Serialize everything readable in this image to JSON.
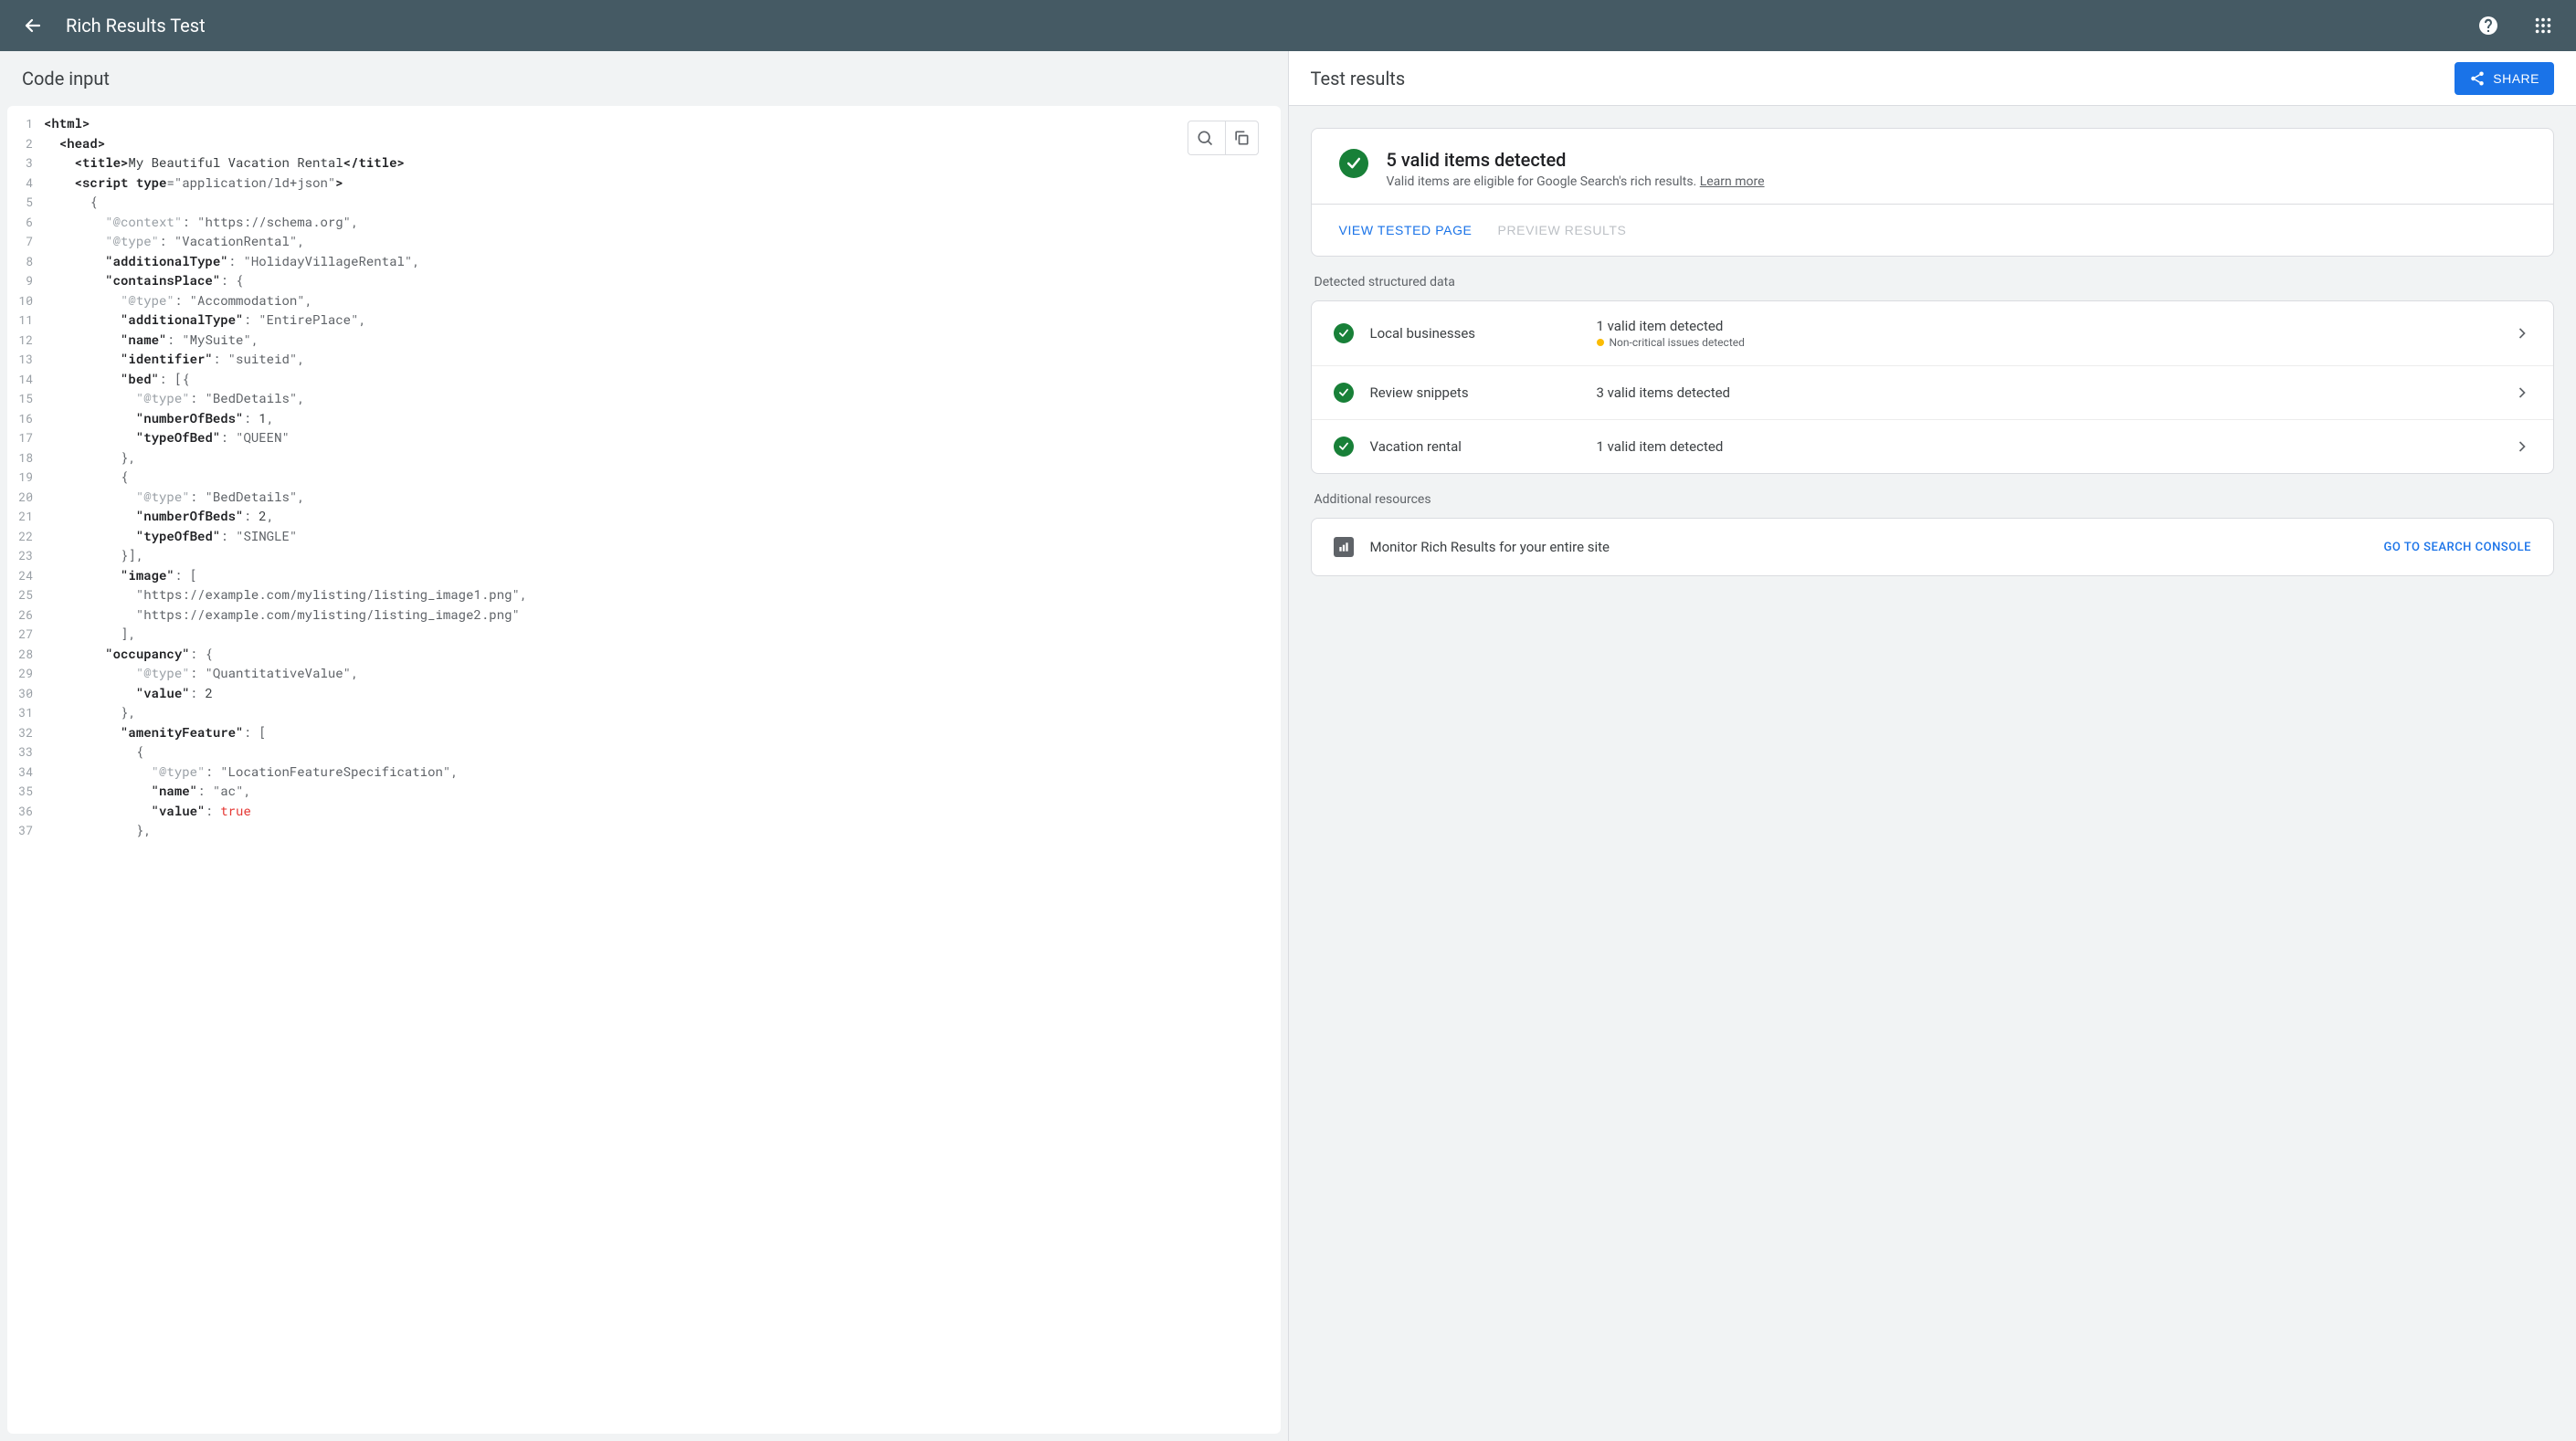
{
  "topbar": {
    "title": "Rich Results Test"
  },
  "left": {
    "title": "Code input",
    "code_lines": [
      {
        "n": 1,
        "tokens": [
          [
            "tag",
            "<html>"
          ]
        ]
      },
      {
        "n": 2,
        "tokens": [
          [
            "txt",
            "  "
          ],
          [
            "tag",
            "<head>"
          ]
        ]
      },
      {
        "n": 3,
        "tokens": [
          [
            "txt",
            "    "
          ],
          [
            "tag",
            "<title>"
          ],
          [
            "txt",
            "My Beautiful Vacation Rental"
          ],
          [
            "tag",
            "</title>"
          ]
        ]
      },
      {
        "n": 4,
        "tokens": [
          [
            "txt",
            "    "
          ],
          [
            "tag",
            "<script "
          ],
          [
            "attr",
            "type"
          ],
          [
            "punc",
            "="
          ],
          [
            "str",
            "\"application/ld+json\""
          ],
          [
            "tag",
            ">"
          ]
        ]
      },
      {
        "n": 5,
        "tokens": [
          [
            "txt",
            "      "
          ],
          [
            "punc",
            "{"
          ]
        ]
      },
      {
        "n": 6,
        "tokens": [
          [
            "txt",
            "        "
          ],
          [
            "keygray",
            "\"@context\""
          ],
          [
            "punc",
            ": "
          ],
          [
            "str",
            "\"https://schema.org\""
          ],
          [
            "punc",
            ","
          ]
        ]
      },
      {
        "n": 7,
        "tokens": [
          [
            "txt",
            "        "
          ],
          [
            "keygray",
            "\"@type\""
          ],
          [
            "punc",
            ": "
          ],
          [
            "str",
            "\"VacationRental\""
          ],
          [
            "punc",
            ","
          ]
        ]
      },
      {
        "n": 8,
        "tokens": [
          [
            "txt",
            "        "
          ],
          [
            "key",
            "\"additionalType\""
          ],
          [
            "punc",
            ": "
          ],
          [
            "str",
            "\"HolidayVillageRental\""
          ],
          [
            "punc",
            ","
          ]
        ]
      },
      {
        "n": 9,
        "tokens": [
          [
            "txt",
            "        "
          ],
          [
            "key",
            "\"containsPlace\""
          ],
          [
            "punc",
            ": {"
          ]
        ]
      },
      {
        "n": 10,
        "tokens": [
          [
            "txt",
            "          "
          ],
          [
            "keygray",
            "\"@type\""
          ],
          [
            "punc",
            ": "
          ],
          [
            "str",
            "\"Accommodation\""
          ],
          [
            "punc",
            ","
          ]
        ]
      },
      {
        "n": 11,
        "tokens": [
          [
            "txt",
            "          "
          ],
          [
            "key",
            "\"additionalType\""
          ],
          [
            "punc",
            ": "
          ],
          [
            "str",
            "\"EntirePlace\""
          ],
          [
            "punc",
            ","
          ]
        ]
      },
      {
        "n": 12,
        "tokens": [
          [
            "txt",
            "          "
          ],
          [
            "key",
            "\"name\""
          ],
          [
            "punc",
            ": "
          ],
          [
            "str",
            "\"MySuite\""
          ],
          [
            "punc",
            ","
          ]
        ]
      },
      {
        "n": 13,
        "tokens": [
          [
            "txt",
            "          "
          ],
          [
            "key",
            "\"identifier\""
          ],
          [
            "punc",
            ": "
          ],
          [
            "str",
            "\"suiteid\""
          ],
          [
            "punc",
            ","
          ]
        ]
      },
      {
        "n": 14,
        "tokens": [
          [
            "txt",
            "          "
          ],
          [
            "key",
            "\"bed\""
          ],
          [
            "punc",
            ": [{"
          ]
        ]
      },
      {
        "n": 15,
        "tokens": [
          [
            "txt",
            "            "
          ],
          [
            "keygray",
            "\"@type\""
          ],
          [
            "punc",
            ": "
          ],
          [
            "str",
            "\"BedDetails\""
          ],
          [
            "punc",
            ","
          ]
        ]
      },
      {
        "n": 16,
        "tokens": [
          [
            "txt",
            "            "
          ],
          [
            "key",
            "\"numberOfBeds\""
          ],
          [
            "punc",
            ": "
          ],
          [
            "num",
            "1"
          ],
          [
            "punc",
            ","
          ]
        ]
      },
      {
        "n": 17,
        "tokens": [
          [
            "txt",
            "            "
          ],
          [
            "key",
            "\"typeOfBed\""
          ],
          [
            "punc",
            ": "
          ],
          [
            "str",
            "\"QUEEN\""
          ]
        ]
      },
      {
        "n": 18,
        "tokens": [
          [
            "txt",
            "          "
          ],
          [
            "punc",
            "},"
          ]
        ]
      },
      {
        "n": 19,
        "tokens": [
          [
            "txt",
            "          "
          ],
          [
            "punc",
            "{"
          ]
        ]
      },
      {
        "n": 20,
        "tokens": [
          [
            "txt",
            "            "
          ],
          [
            "keygray",
            "\"@type\""
          ],
          [
            "punc",
            ": "
          ],
          [
            "str",
            "\"BedDetails\""
          ],
          [
            "punc",
            ","
          ]
        ]
      },
      {
        "n": 21,
        "tokens": [
          [
            "txt",
            "            "
          ],
          [
            "key",
            "\"numberOfBeds\""
          ],
          [
            "punc",
            ": "
          ],
          [
            "num",
            "2"
          ],
          [
            "punc",
            ","
          ]
        ]
      },
      {
        "n": 22,
        "tokens": [
          [
            "txt",
            "            "
          ],
          [
            "key",
            "\"typeOfBed\""
          ],
          [
            "punc",
            ": "
          ],
          [
            "str",
            "\"SINGLE\""
          ]
        ]
      },
      {
        "n": 23,
        "tokens": [
          [
            "txt",
            "          "
          ],
          [
            "punc",
            "}],"
          ]
        ]
      },
      {
        "n": 24,
        "tokens": [
          [
            "txt",
            "          "
          ],
          [
            "key",
            "\"image\""
          ],
          [
            "punc",
            ": ["
          ]
        ]
      },
      {
        "n": 25,
        "tokens": [
          [
            "txt",
            "            "
          ],
          [
            "str",
            "\"https://example.com/mylisting/listing_image1.png\""
          ],
          [
            "punc",
            ","
          ]
        ]
      },
      {
        "n": 26,
        "tokens": [
          [
            "txt",
            "            "
          ],
          [
            "str",
            "\"https://example.com/mylisting/listing_image2.png\""
          ]
        ]
      },
      {
        "n": 27,
        "tokens": [
          [
            "txt",
            "          "
          ],
          [
            "punc",
            "],"
          ]
        ]
      },
      {
        "n": 28,
        "tokens": [
          [
            "txt",
            "        "
          ],
          [
            "key",
            "\"occupancy\""
          ],
          [
            "punc",
            ": {"
          ]
        ]
      },
      {
        "n": 29,
        "tokens": [
          [
            "txt",
            "            "
          ],
          [
            "keygray",
            "\"@type\""
          ],
          [
            "punc",
            ": "
          ],
          [
            "str",
            "\"QuantitativeValue\""
          ],
          [
            "punc",
            ","
          ]
        ]
      },
      {
        "n": 30,
        "tokens": [
          [
            "txt",
            "            "
          ],
          [
            "key",
            "\"value\""
          ],
          [
            "punc",
            ": "
          ],
          [
            "num",
            "2"
          ]
        ]
      },
      {
        "n": 31,
        "tokens": [
          [
            "txt",
            "          "
          ],
          [
            "punc",
            "},"
          ]
        ]
      },
      {
        "n": 32,
        "tokens": [
          [
            "txt",
            "          "
          ],
          [
            "key",
            "\"amenityFeature\""
          ],
          [
            "punc",
            ": ["
          ]
        ]
      },
      {
        "n": 33,
        "tokens": [
          [
            "txt",
            "            "
          ],
          [
            "punc",
            "{"
          ]
        ]
      },
      {
        "n": 34,
        "tokens": [
          [
            "txt",
            "              "
          ],
          [
            "keygray",
            "\"@type\""
          ],
          [
            "punc",
            ": "
          ],
          [
            "str",
            "\"LocationFeatureSpecification\""
          ],
          [
            "punc",
            ","
          ]
        ]
      },
      {
        "n": 35,
        "tokens": [
          [
            "txt",
            "              "
          ],
          [
            "key",
            "\"name\""
          ],
          [
            "punc",
            ": "
          ],
          [
            "str",
            "\"ac\""
          ],
          [
            "punc",
            ","
          ]
        ]
      },
      {
        "n": 36,
        "tokens": [
          [
            "txt",
            "              "
          ],
          [
            "key",
            "\"value\""
          ],
          [
            "punc",
            ": "
          ],
          [
            "true",
            "true"
          ]
        ]
      },
      {
        "n": 37,
        "tokens": [
          [
            "txt",
            "            "
          ],
          [
            "punc",
            "},"
          ]
        ]
      }
    ]
  },
  "right": {
    "title": "Test results",
    "share_label": "SHARE",
    "summary": {
      "title": "5 valid items detected",
      "subtitle_prefix": "Valid items are eligible for Google Search's rich results. ",
      "learn_more": "Learn more",
      "view_tested": "VIEW TESTED PAGE",
      "preview_results": "PREVIEW RESULTS"
    },
    "detected_label": "Detected structured data",
    "items": [
      {
        "name": "Local businesses",
        "status": "1 valid item detected",
        "warn": "Non-critical issues detected"
      },
      {
        "name": "Review snippets",
        "status": "3 valid items detected",
        "warn": null
      },
      {
        "name": "Vacation rental",
        "status": "1 valid item detected",
        "warn": null
      }
    ],
    "additional_label": "Additional resources",
    "resource": {
      "label": "Monitor Rich Results for your entire site",
      "link": "GO TO SEARCH CONSOLE"
    }
  }
}
